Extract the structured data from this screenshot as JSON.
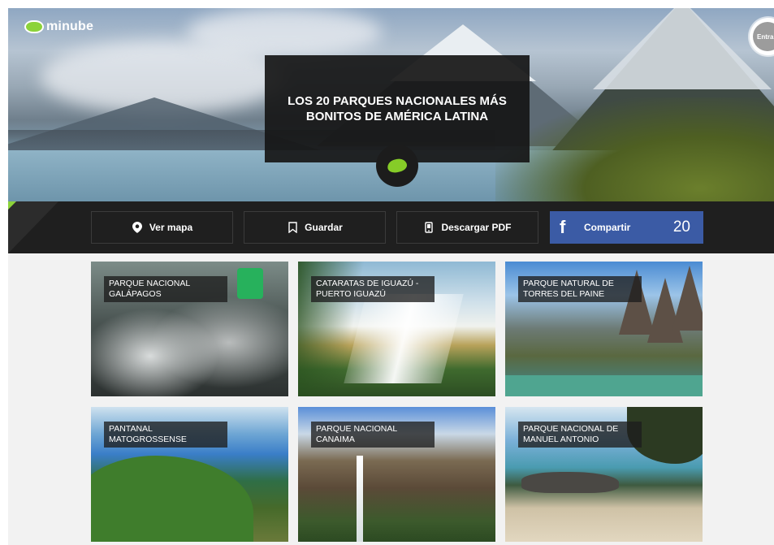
{
  "brand": {
    "name": "minube"
  },
  "header": {
    "login_label": "Entra"
  },
  "hero": {
    "title": "LOS 20 PARQUES NACIONALES MÁS BONITOS DE AMÉRICA LATINA"
  },
  "toolbar": {
    "map_label": "Ver mapa",
    "save_label": "Guardar",
    "pdf_label": "Descargar PDF",
    "share_label": "Compartir",
    "share_count": "20"
  },
  "cards": [
    {
      "label": "PARQUE NACIONAL GALÁPAGOS"
    },
    {
      "label": "CATARATAS DE IGUAZÚ - PUERTO IGUAZÚ"
    },
    {
      "label": "PARQUE NATURAL DE TORRES DEL PAINE"
    },
    {
      "label": "PANTANAL MATOGROSSENSE"
    },
    {
      "label": "PARQUE NACIONAL CANAIMA"
    },
    {
      "label": "PARQUE NACIONAL DE MANUEL ANTONIO"
    }
  ],
  "colors": {
    "accent_green": "#8cd33a",
    "facebook_blue": "#3b5ba5",
    "toolbar_bg": "#1f1f1f"
  },
  "icons": [
    "map-pin-icon",
    "bookmark-icon",
    "pdf-phone-icon",
    "facebook-icon"
  ]
}
